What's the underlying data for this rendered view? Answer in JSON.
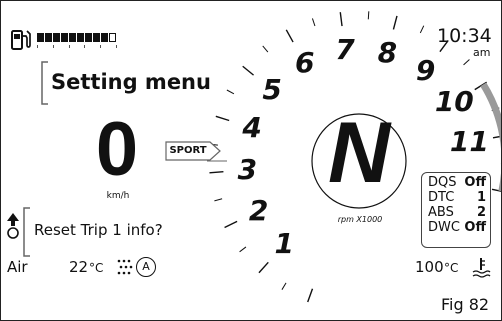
{
  "header": {
    "fuel_icon": "fuel-pump-icon",
    "fuel_segments_total": 10,
    "fuel_segments_filled": 9,
    "clock_time": "10:34",
    "clock_period": "am"
  },
  "menu": {
    "title": "Setting menu",
    "item": "Reset Trip 1 info?"
  },
  "speed": {
    "value": "0",
    "unit": "km/h"
  },
  "riding_mode": "SPORT",
  "gear": "N",
  "tachometer": {
    "unit_label": "rpm X1000",
    "numbers": [
      "1",
      "2",
      "3",
      "4",
      "5",
      "6",
      "7",
      "8",
      "9",
      "10",
      "11"
    ],
    "redline_start": 10,
    "max": 12
  },
  "status": [
    {
      "label": "DQS",
      "value": "Off"
    },
    {
      "label": "DTC",
      "value": "1"
    },
    {
      "label": "ABS",
      "value": "2"
    },
    {
      "label": "DWC",
      "value": "Off"
    }
  ],
  "air": {
    "label": "Air",
    "temp_value": "22",
    "temp_unit": "°C",
    "auto_headlight_letter": "A"
  },
  "coolant": {
    "value": "100",
    "unit": "°C",
    "icon": "coolant-temp-icon"
  },
  "figure_label": "Fig 82",
  "colors": {
    "foreground": "#111111",
    "redline": "#9a9a9a",
    "background": "#ffffff"
  }
}
